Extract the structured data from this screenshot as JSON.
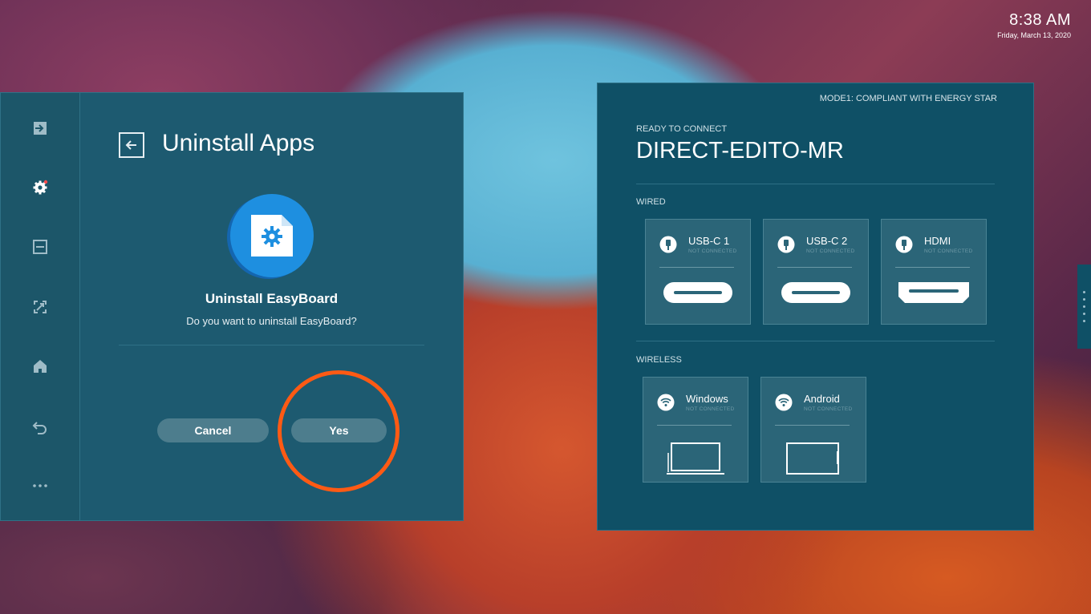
{
  "clock": {
    "time": "8:38 AM",
    "date": "Friday, March 13, 2020"
  },
  "sidebar": {
    "items": [
      {
        "icon": "input-source-icon"
      },
      {
        "icon": "settings-gear-icon",
        "badge_color": "#ff4d4d"
      },
      {
        "icon": "display-panel-icon"
      },
      {
        "icon": "screen-capture-icon"
      },
      {
        "icon": "home-icon"
      },
      {
        "icon": "back-return-icon"
      },
      {
        "icon": "more-dots-icon"
      }
    ]
  },
  "uninstall": {
    "page_title": "Uninstall Apps",
    "app_icon": "app-settings-file-icon",
    "dialog_title": "Uninstall EasyBoard",
    "dialog_text": "Do you want to uninstall EasyBoard?",
    "cancel_label": "Cancel",
    "yes_label": "Yes",
    "highlight_color": "#ff5a14"
  },
  "connect": {
    "mode": "MODE1: COMPLIANT WITH ENERGY STAR",
    "ready_label": "READY TO CONNECT",
    "network_name": "DIRECT-EDITO-MR",
    "wired_label": "WIRED",
    "wireless_label": "WIRELESS",
    "wired": [
      {
        "title": "USB-C 1",
        "status": "NOT CONNECTED",
        "icon": "plug-icon"
      },
      {
        "title": "USB-C 2",
        "status": "NOT CONNECTED",
        "icon": "plug-icon"
      },
      {
        "title": "HDMI",
        "status": "NOT CONNECTED",
        "icon": "plug-icon"
      }
    ],
    "wireless": [
      {
        "title": "Windows",
        "status": "NOT CONNECTED",
        "icon": "wifi-icon"
      },
      {
        "title": "Android",
        "status": "NOT CONNECTED",
        "icon": "wifi-icon"
      }
    ]
  }
}
